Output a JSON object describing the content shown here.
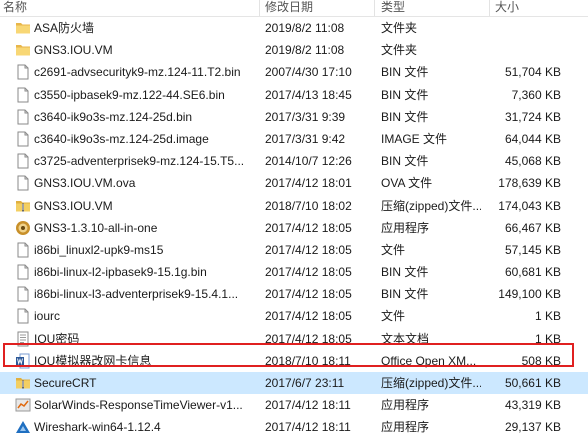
{
  "header": {
    "name": "名称",
    "date": "修改日期",
    "type": "类型",
    "size": "大小"
  },
  "files": [
    {
      "name": "ASA防火墙",
      "date": "2019/8/2 11:08",
      "type": "文件夹",
      "size": "",
      "icon": "folder-icon"
    },
    {
      "name": "GNS3.IOU.VM",
      "date": "2019/8/2 11:08",
      "type": "文件夹",
      "size": "",
      "icon": "folder-icon"
    },
    {
      "name": "c2691-advsecurityk9-mz.124-11.T2.bin",
      "date": "2007/4/30 17:10",
      "type": "BIN 文件",
      "size": "51,704 KB",
      "icon": "file-icon"
    },
    {
      "name": "c3550-ipbasek9-mz.122-44.SE6.bin",
      "date": "2017/4/13 18:45",
      "type": "BIN 文件",
      "size": "7,360 KB",
      "icon": "file-icon"
    },
    {
      "name": "c3640-ik9o3s-mz.124-25d.bin",
      "date": "2017/3/31 9:39",
      "type": "BIN 文件",
      "size": "31,724 KB",
      "icon": "file-icon"
    },
    {
      "name": "c3640-ik9o3s-mz.124-25d.image",
      "date": "2017/3/31 9:42",
      "type": "IMAGE 文件",
      "size": "64,044 KB",
      "icon": "file-icon"
    },
    {
      "name": "c3725-adventerprisek9-mz.124-15.T5...",
      "date": "2014/10/7 12:26",
      "type": "BIN 文件",
      "size": "45,068 KB",
      "icon": "file-icon"
    },
    {
      "name": "GNS3.IOU.VM.ova",
      "date": "2017/4/12 18:01",
      "type": "OVA 文件",
      "size": "178,639 KB",
      "icon": "file-icon"
    },
    {
      "name": "GNS3.IOU.VM",
      "date": "2018/7/10 18:02",
      "type": "压缩(zipped)文件...",
      "size": "174,043 KB",
      "icon": "zip-icon"
    },
    {
      "name": "GNS3-1.3.10-all-in-one",
      "date": "2017/4/12 18:05",
      "type": "应用程序",
      "size": "66,467 KB",
      "icon": "gns3-app-icon"
    },
    {
      "name": "i86bi_linuxl2-upk9-ms15",
      "date": "2017/4/12 18:05",
      "type": "文件",
      "size": "57,145 KB",
      "icon": "file-icon"
    },
    {
      "name": "i86bi-linux-l2-ipbasek9-15.1g.bin",
      "date": "2017/4/12 18:05",
      "type": "BIN 文件",
      "size": "60,681 KB",
      "icon": "file-icon"
    },
    {
      "name": "i86bi-linux-l3-adventerprisek9-15.4.1...",
      "date": "2017/4/12 18:05",
      "type": "BIN 文件",
      "size": "149,100 KB",
      "icon": "file-icon"
    },
    {
      "name": "iourc",
      "date": "2017/4/12 18:05",
      "type": "文件",
      "size": "1 KB",
      "icon": "file-icon"
    },
    {
      "name": "IOU密码",
      "date": "2017/4/12 18:05",
      "type": "文本文档",
      "size": "1 KB",
      "icon": "text-doc-icon"
    },
    {
      "name": "IOU模拟器改网卡信息",
      "date": "2018/7/10 18:11",
      "type": "Office Open XM...",
      "size": "508 KB",
      "icon": "word-doc-icon"
    },
    {
      "name": "SecureCRT",
      "date": "2017/6/7 23:11",
      "type": "压缩(zipped)文件...",
      "size": "50,661 KB",
      "icon": "zip-icon",
      "selected": true
    },
    {
      "name": "SolarWinds-ResponseTimeViewer-v1...",
      "date": "2017/4/12 18:11",
      "type": "应用程序",
      "size": "43,319 KB",
      "icon": "solarwinds-app-icon"
    },
    {
      "name": "Wireshark-win64-1.12.4",
      "date": "2017/4/12 18:11",
      "type": "应用程序",
      "size": "29,137 KB",
      "icon": "wireshark-app-icon"
    }
  ],
  "colors": {
    "selection": "#cce8ff",
    "highlight_border": "#e02020",
    "folder": "#f8d775"
  }
}
